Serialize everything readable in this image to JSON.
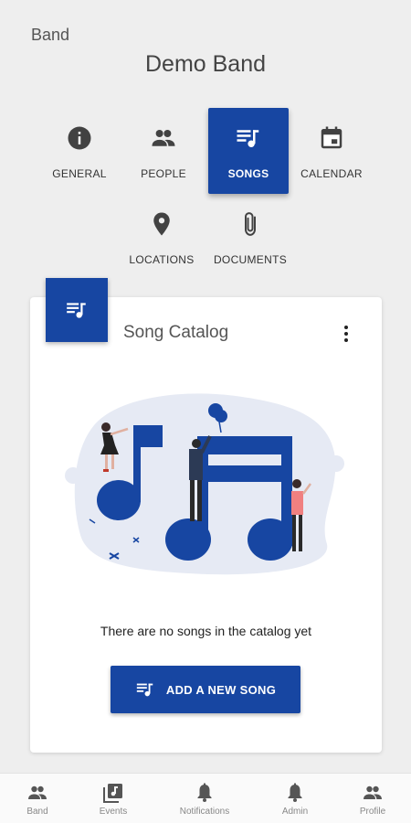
{
  "header": {
    "breadcrumb": "Band",
    "title": "Demo Band"
  },
  "tabs": [
    {
      "label": "GENERAL",
      "icon": "info-icon"
    },
    {
      "label": "PEOPLE",
      "icon": "people-icon"
    },
    {
      "label": "SONGS",
      "icon": "playlist-music-icon",
      "active": true
    },
    {
      "label": "CALENDAR",
      "icon": "calendar-icon"
    },
    {
      "label": "LOCATIONS",
      "icon": "location-pin-icon"
    },
    {
      "label": "DOCUMENTS",
      "icon": "paperclip-icon"
    }
  ],
  "catalog": {
    "title": "Song Catalog",
    "empty_message": "There are no songs in the catalog yet",
    "add_button_label": "ADD A NEW SONG"
  },
  "bottom_nav": [
    {
      "label": "Band",
      "icon": "people-icon"
    },
    {
      "label": "Events",
      "icon": "music-library-icon"
    },
    {
      "label": "Notifications",
      "icon": "bell-icon"
    },
    {
      "label": "Admin",
      "icon": "bell-icon"
    },
    {
      "label": "Profile",
      "icon": "people-icon"
    }
  ],
  "colors": {
    "primary": "#1746a2",
    "background": "#eeeeee",
    "card": "#ffffff",
    "illustration_light": "#e6eaf4"
  }
}
